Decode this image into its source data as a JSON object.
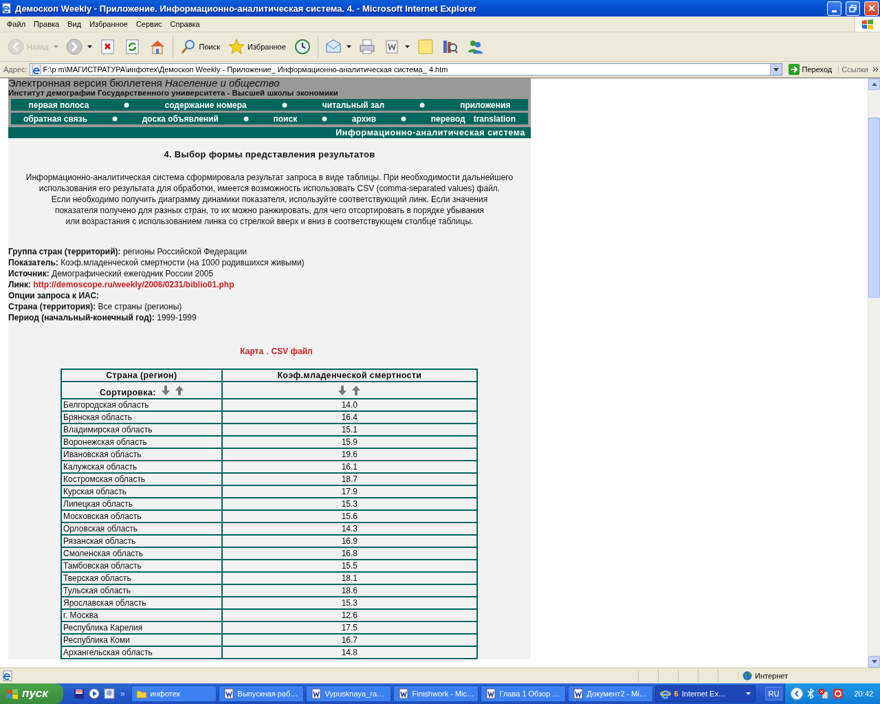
{
  "window": {
    "title": "Демоскоп Weekly - Приложение. Информационно-аналитическая система. 4. - Microsoft Internet Explorer"
  },
  "menu": [
    "Файл",
    "Правка",
    "Вид",
    "Избранное",
    "Сервис",
    "Справка"
  ],
  "toolbar": [
    {
      "kind": "back",
      "label": "Назад",
      "disabled": true,
      "dropdown": true
    },
    {
      "kind": "forward",
      "disabled": false,
      "dropdown": true
    },
    {
      "kind": "stop",
      "disabled": false,
      "dropdown": false
    },
    {
      "kind": "refresh",
      "disabled": false,
      "dropdown": false
    },
    {
      "kind": "home",
      "disabled": false,
      "dropdown": false
    },
    {
      "kind": "search",
      "label": "Поиск",
      "disabled": false,
      "dropdown": false
    },
    {
      "kind": "favorites",
      "label": "Избранное",
      "disabled": false,
      "dropdown": false
    },
    {
      "kind": "history",
      "disabled": false,
      "dropdown": false
    },
    {
      "kind": "mail",
      "disabled": false,
      "dropdown": true
    },
    {
      "kind": "print",
      "disabled": false,
      "dropdown": false
    },
    {
      "kind": "edit",
      "disabled": false,
      "dropdown": true
    },
    {
      "kind": "notes",
      "disabled": false,
      "dropdown": false
    },
    {
      "kind": "research",
      "disabled": false,
      "dropdown": false
    },
    {
      "kind": "messenger",
      "disabled": false,
      "dropdown": false
    }
  ],
  "address": {
    "label": "Адрес:",
    "value": "F:\\p m\\МАГИСТРАТУРА\\инфотех\\Демоскоп Weekly - Приложение_ Информационно-аналитическая система_ 4.htm",
    "go": "Переход",
    "links": "Ссылки"
  },
  "page": {
    "bulletin": "Электронная версия бюллетеня *Население и общество*",
    "institute": "Институт демографии Государственного университета - Высшей школы экономики",
    "nav_rows": [
      [
        [
          "первая полоса"
        ],
        [
          "содержание номера"
        ],
        [
          "читальный зал"
        ],
        [
          "приложения"
        ]
      ],
      [
        [
          "обратная связь"
        ],
        [
          "доска объявлений"
        ],
        [
          "поиск"
        ],
        [
          "архив"
        ],
        [
          "перевод",
          "translation"
        ]
      ]
    ],
    "section": "Информационно-аналитическая система",
    "heading": "4. Выбор формы представления результатов",
    "intro_lines": [
      "Информационно-аналитическая система сформировала результат запроса в виде таблицы. При необходимости дальнейшего",
      "использования его результата для обработки, имеется возможность использовать CSV (comma-separated values) файл.",
      "Если необходимо получить диаграмму динамики показателя, используйте соответствующий линк. Если значения",
      "показателя получено для разных стран, то их можно ранжировать, для чего отсортировать в порядке убывания",
      "или возрастания с использованием линка со стрелкой вверх и вниз в соответствующем столбце таблицы."
    ],
    "params": [
      {
        "label": "Группа стран (территорий):",
        "value": "регионы Российской Федерации",
        "kind": "text"
      },
      {
        "label": "Показатель:",
        "value": "Коэф.младенческой смертности (на 1000 родившихся живыми)",
        "kind": "text"
      },
      {
        "label": "Источник:",
        "value": "Демографический ежегодник России 2005",
        "kind": "text"
      },
      {
        "label": "Линк:",
        "value": "http://demoscope.ru/weekly/2006/0231/biblio01.php",
        "kind": "link"
      },
      {
        "label": "Опции запроса к ИАС:",
        "kind": "heading"
      },
      {
        "label": "Страна (территория):",
        "value": "Все страны (регионы)",
        "kind": "text"
      },
      {
        "label": "Период (начальный-конечный год):",
        "value": "1999-1999",
        "kind": "text"
      }
    ],
    "links": {
      "items": [
        "Карта",
        "CSV файл"
      ],
      "separator": "."
    },
    "table": {
      "columns": [
        "Страна (регион)",
        "Коэф.младенческой смертности"
      ],
      "sort_label": "Сортировка:",
      "rows": [
        {
          "region": "Белгородская область",
          "value": "14.0"
        },
        {
          "region": "Брянская область",
          "value": "16.4"
        },
        {
          "region": "Владимирская область",
          "value": "15.1"
        },
        {
          "region": "Воронежская область",
          "value": "15.9"
        },
        {
          "region": "Ивановская область",
          "value": "19.6"
        },
        {
          "region": "Калужская область",
          "value": "16.1"
        },
        {
          "region": "Костромская область",
          "value": "18.7"
        },
        {
          "region": "Курская область",
          "value": "17.9"
        },
        {
          "region": "Липецкая область",
          "value": "15.3"
        },
        {
          "region": "Московская область",
          "value": "15.6"
        },
        {
          "region": "Орловская область",
          "value": "14.3"
        },
        {
          "region": "Рязанская область",
          "value": "16.9"
        },
        {
          "region": "Смоленская область",
          "value": "16.8"
        },
        {
          "region": "Тамбовская область",
          "value": "15.5"
        },
        {
          "region": "Тверская область",
          "value": "18.1"
        },
        {
          "region": "Тульская область",
          "value": "18.6"
        },
        {
          "region": "Ярославская область",
          "value": "15.3"
        },
        {
          "region": "г. Москва",
          "value": "12.6"
        },
        {
          "region": "Республика Карелия",
          "value": "17.5"
        },
        {
          "region": "Республика Коми",
          "value": "16.7"
        },
        {
          "region": "Архангельская область",
          "value": "14.8"
        }
      ]
    }
  },
  "status_bar": {
    "zone": "Интернет"
  },
  "taskbar": {
    "start": "пуск",
    "more": "»",
    "tasks": [
      {
        "label": "инфотех",
        "kind": "folder",
        "selected": false
      },
      {
        "label": "Выпускная раб…",
        "kind": "word",
        "selected": false
      },
      {
        "label": "Vypusknaya_ra…",
        "kind": "word",
        "selected": false
      },
      {
        "label": "Finishwork - Mic…",
        "kind": "word",
        "selected": false
      },
      {
        "label": "Глава 1 Обзор …",
        "kind": "word",
        "selected": false
      },
      {
        "label": "Документ2 - Mi…",
        "kind": "word",
        "selected": false
      },
      {
        "label": "Internet Ex…",
        "count": "6",
        "kind": "ie",
        "selected": true
      }
    ],
    "language": "RU",
    "time": "20:42"
  }
}
